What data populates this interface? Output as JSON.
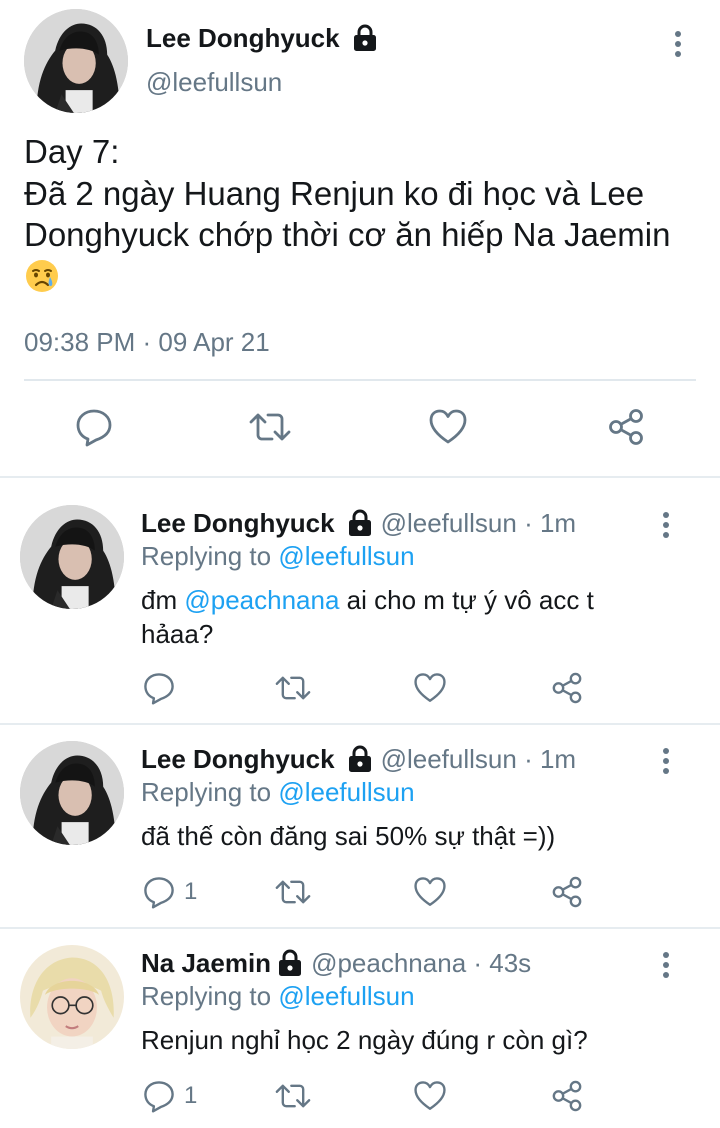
{
  "main_tweet": {
    "author_name": "Lee Donghyuck",
    "author_handle": "@leefullsun",
    "text_line1": "Day 7:",
    "text_body": "Đã 2 ngày Huang Renjun ko đi học và Lee Donghyuck chớp thời cơ ăn hiếp Na Jaemin",
    "text_emoji": "crying-face-emoji",
    "timestamp": "09:38 PM · 09 Apr 21",
    "icons": [
      "lock-icon",
      "more-vertical-icon",
      "reply-icon",
      "retweet-icon",
      "like-icon",
      "share-icon"
    ]
  },
  "replies": [
    {
      "author_name": "Lee Donghyuck",
      "author_handle": "@leefullsun · 1m",
      "replying_prefix": "Replying to",
      "replying_to": "@leefullsun",
      "text_before": "đm ",
      "text_mention": "@peachnana",
      "text_after": " ai cho m tự ý vô acc t hảaa?",
      "reply_count": ""
    },
    {
      "author_name": "Lee Donghyuck",
      "author_handle": "@leefullsun · 1m",
      "replying_prefix": "Replying to",
      "replying_to": "@leefullsun",
      "text_before": "đã thế còn đăng sai 50% sự thật =))",
      "text_mention": "",
      "text_after": "",
      "reply_count": "1"
    },
    {
      "author_name": "Na Jaemin",
      "author_handle": "@peachnana · 43s",
      "replying_prefix": "Replying to",
      "replying_to": "@leefullsun",
      "text_before": "Renjun nghỉ học 2 ngày đúng r còn gì?",
      "text_mention": "",
      "text_after": "",
      "reply_count": "1"
    }
  ],
  "colors": {
    "text": "#14171a",
    "secondary": "#657786",
    "link": "#1da1f2",
    "divider": "#e6ecf0"
  }
}
